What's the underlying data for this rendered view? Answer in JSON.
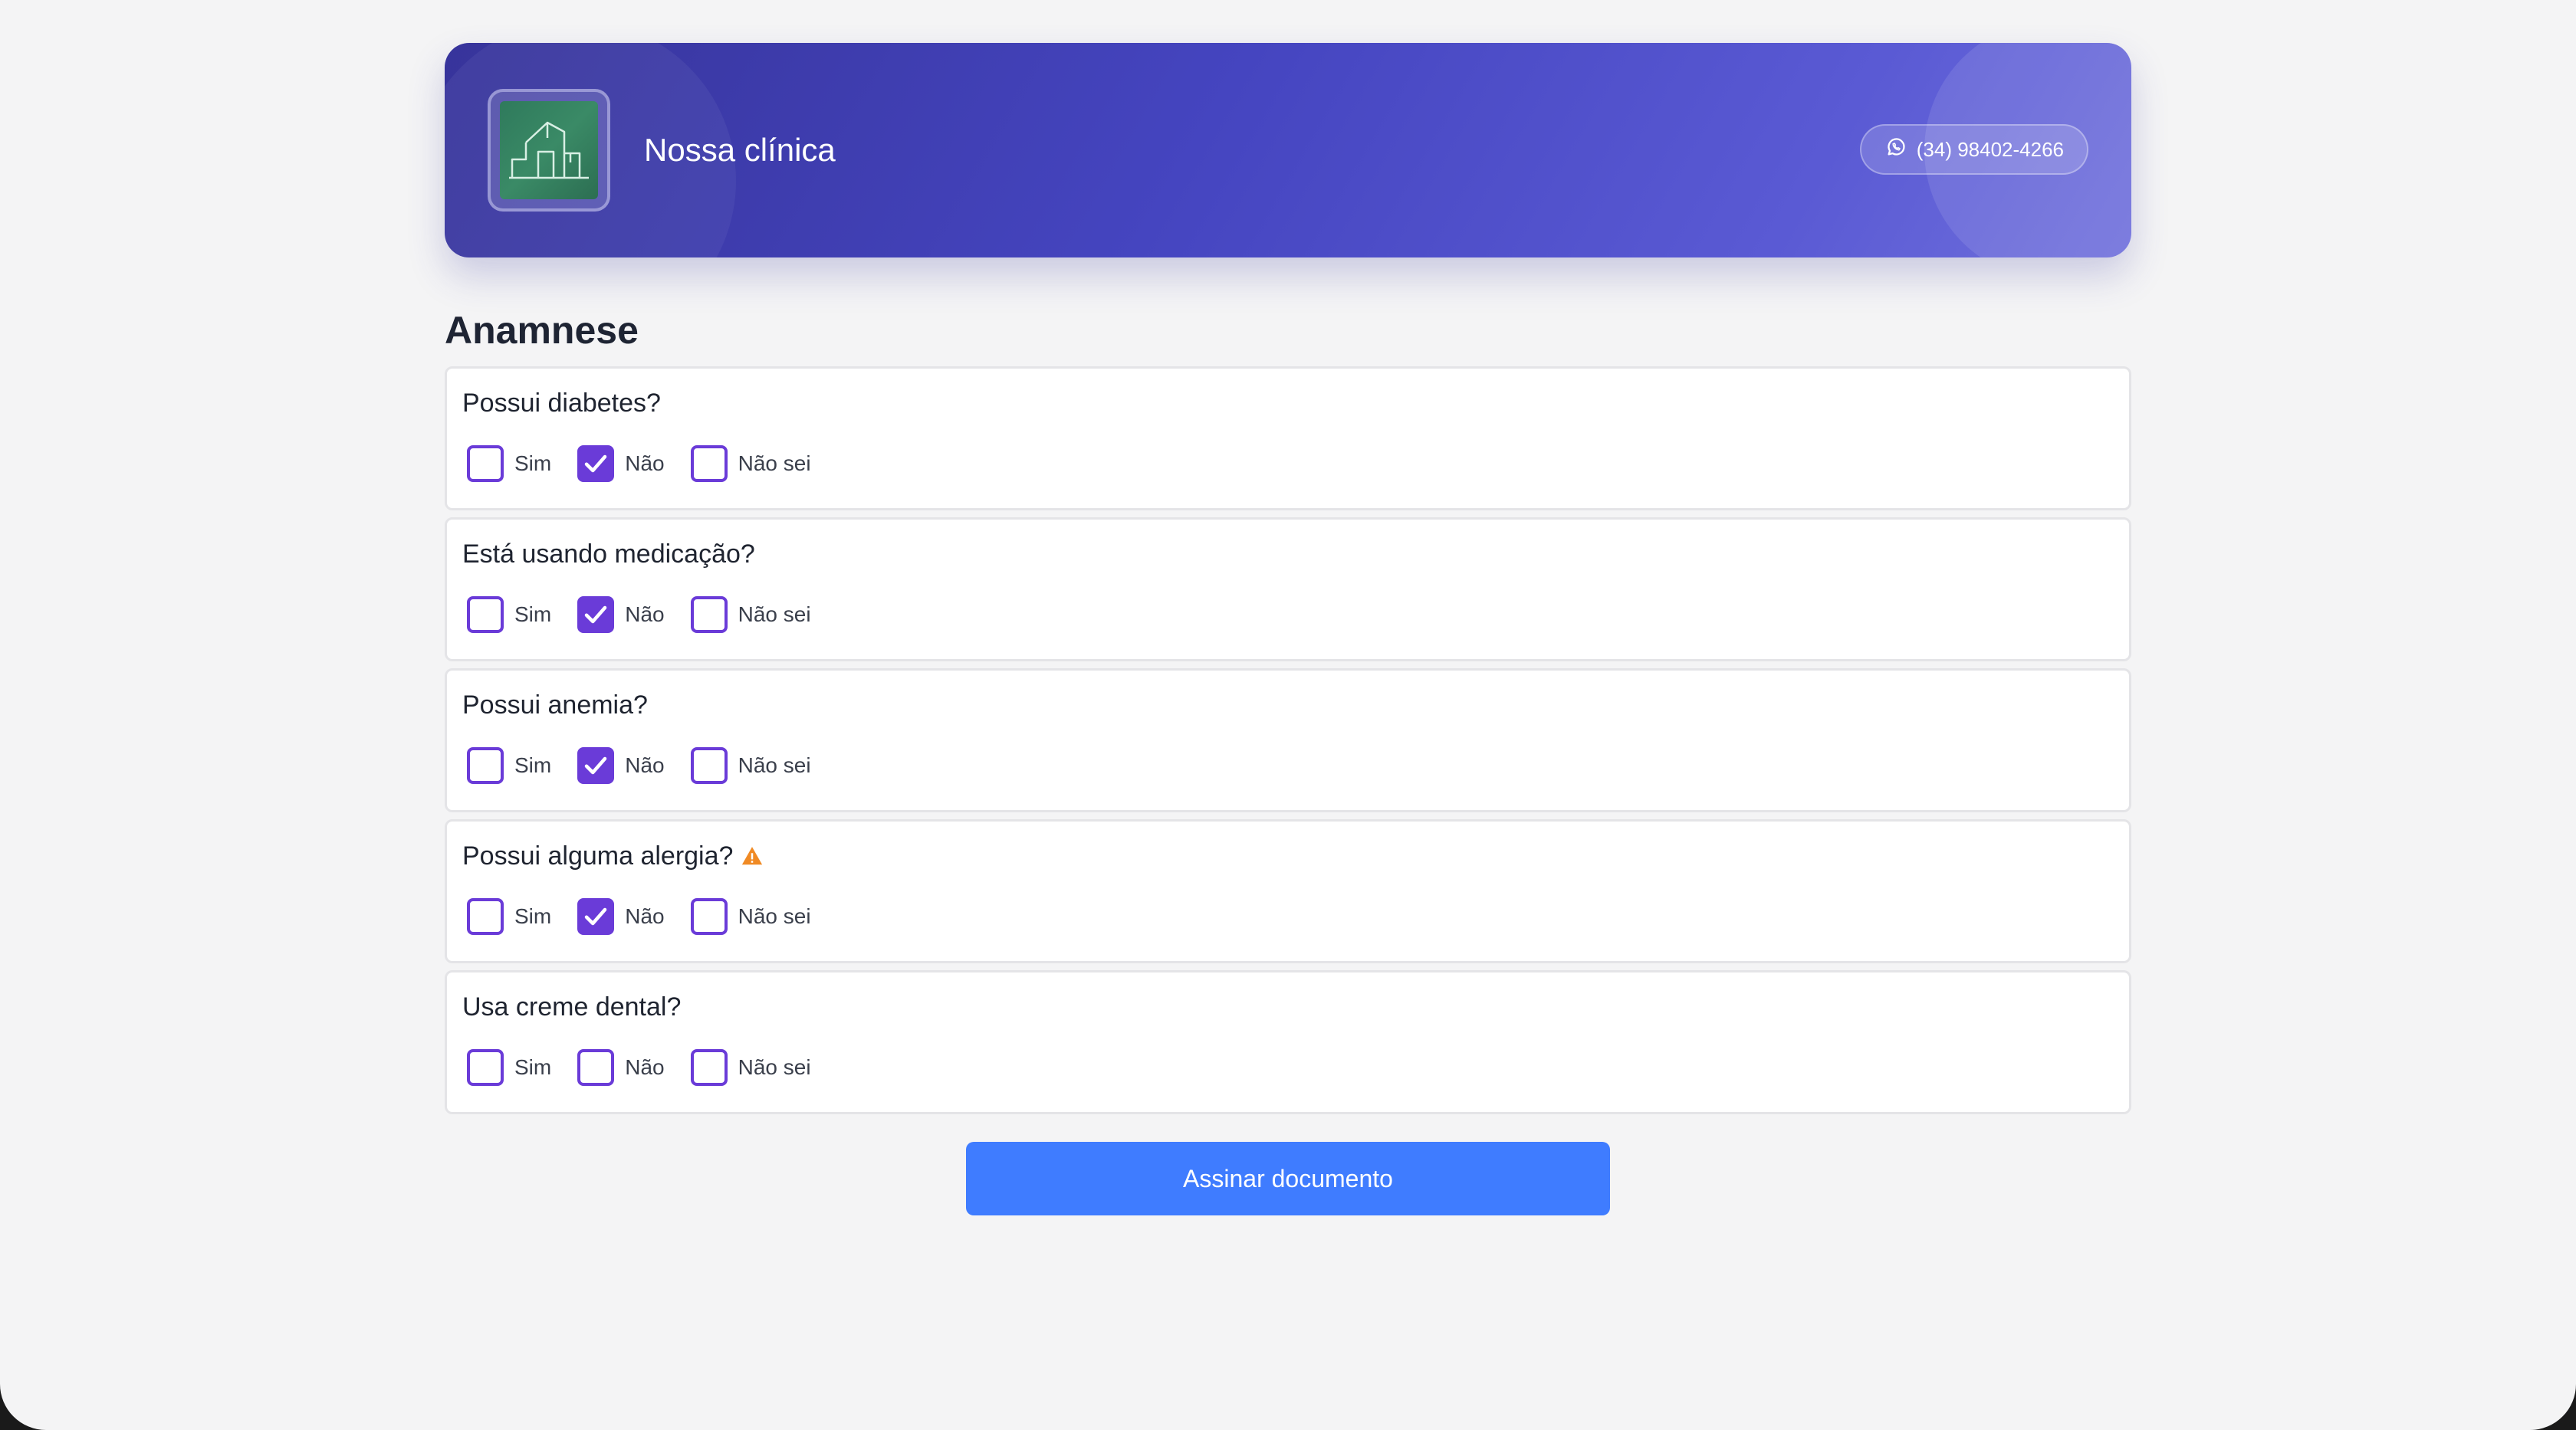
{
  "header": {
    "clinic_name": "Nossa clínica",
    "phone": "(34) 98402-4266",
    "phone_icon": "whatsapp-icon",
    "logo_icon": "building-logo-icon"
  },
  "section": {
    "title": "Anamnese"
  },
  "options_labels": [
    "Sim",
    "Não",
    "Não sei"
  ],
  "questions": [
    {
      "text": "Possui diabetes?",
      "warning": false,
      "selected": "Não"
    },
    {
      "text": "Está usando medicação?",
      "warning": false,
      "selected": "Não"
    },
    {
      "text": "Possui anemia?",
      "warning": false,
      "selected": "Não"
    },
    {
      "text": "Possui alguma alergia?",
      "warning": true,
      "selected": "Não"
    },
    {
      "text": "Usa creme dental?",
      "warning": false,
      "selected": null
    }
  ],
  "submit": {
    "label": "Assinar documento"
  },
  "colors": {
    "accent": "#6a3bd8",
    "button": "#3f7cff",
    "warning": "#f08a24",
    "header_start": "#37349b",
    "header_end": "#6f6fdc"
  }
}
